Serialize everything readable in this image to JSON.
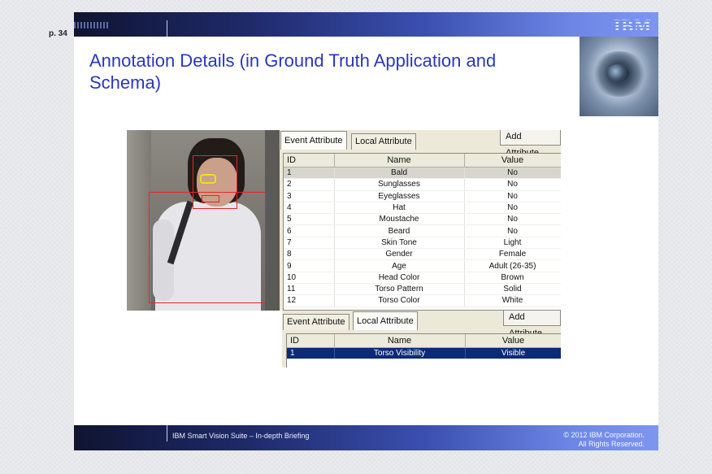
{
  "page_number": "p. 34",
  "logo_text": "IBM",
  "title": "Annotation Details (in Ground Truth Application and Schema)",
  "event_panel": {
    "tabs": [
      "Event Attribute",
      "Local Attribute"
    ],
    "add_button": "Add Attribute",
    "columns": [
      "ID",
      "Name",
      "Value"
    ],
    "rows": [
      [
        "1",
        "Bald",
        "No"
      ],
      [
        "2",
        "Sunglasses",
        "No"
      ],
      [
        "3",
        "Eyeglasses",
        "No"
      ],
      [
        "4",
        "Hat",
        "No"
      ],
      [
        "5",
        "Moustache",
        "No"
      ],
      [
        "6",
        "Beard",
        "No"
      ],
      [
        "7",
        "Skin Tone",
        "Light"
      ],
      [
        "8",
        "Gender",
        "Female"
      ],
      [
        "9",
        "Age",
        "Adult (26-35)"
      ],
      [
        "10",
        "Head Color",
        "Brown"
      ],
      [
        "11",
        "Torso Pattern",
        "Solid"
      ],
      [
        "12",
        "Torso Color",
        "White"
      ]
    ]
  },
  "local_panel": {
    "tabs": [
      "Event Attribute",
      "Local Attribute"
    ],
    "add_button": "Add Attribute",
    "columns": [
      "ID",
      "Name",
      "Value"
    ],
    "rows": [
      [
        "1",
        "Torso Visibility",
        "Visible"
      ]
    ]
  },
  "footer": {
    "left": "IBM Smart Vision Suite – In-depth Briefing",
    "right_line1": "© 2012 IBM Corporation.",
    "right_line2": "All Rights Reserved."
  }
}
